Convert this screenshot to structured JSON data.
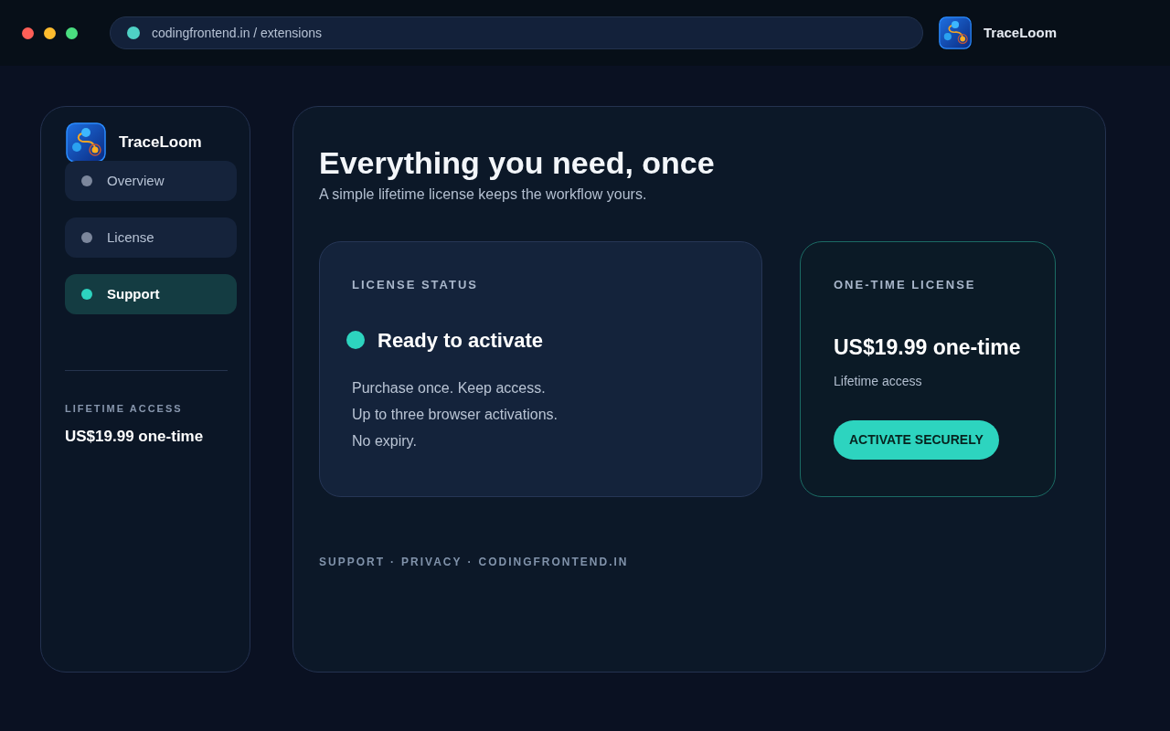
{
  "browser": {
    "address": "codingfrontend.in / extensions",
    "app_name": "TraceLoom"
  },
  "sidebar": {
    "app_name": "TraceLoom",
    "items": [
      {
        "label": "Overview",
        "selected": false
      },
      {
        "label": "License",
        "selected": false
      },
      {
        "label": "Support",
        "selected": true
      }
    ],
    "access_label": "LIFETIME ACCESS",
    "price": "US$19.99 one-time"
  },
  "main": {
    "title": "Everything you need, once",
    "subtitle": "A simple lifetime license keeps the workflow yours.",
    "status_card": {
      "heading": "LICENSE STATUS",
      "status": "Ready to activate",
      "lines": [
        "Purchase once. Keep access.",
        "Up to three browser activations.",
        "No expiry."
      ]
    },
    "offer_card": {
      "heading": "ONE-TIME LICENSE",
      "price": "US$19.99 one-time",
      "note": "Lifetime access",
      "button": "ACTIVATE SECURELY"
    },
    "footer": {
      "separator": "·",
      "links": [
        "SUPPORT",
        "PRIVACY",
        "CODINGFRONTEND.IN"
      ]
    }
  }
}
